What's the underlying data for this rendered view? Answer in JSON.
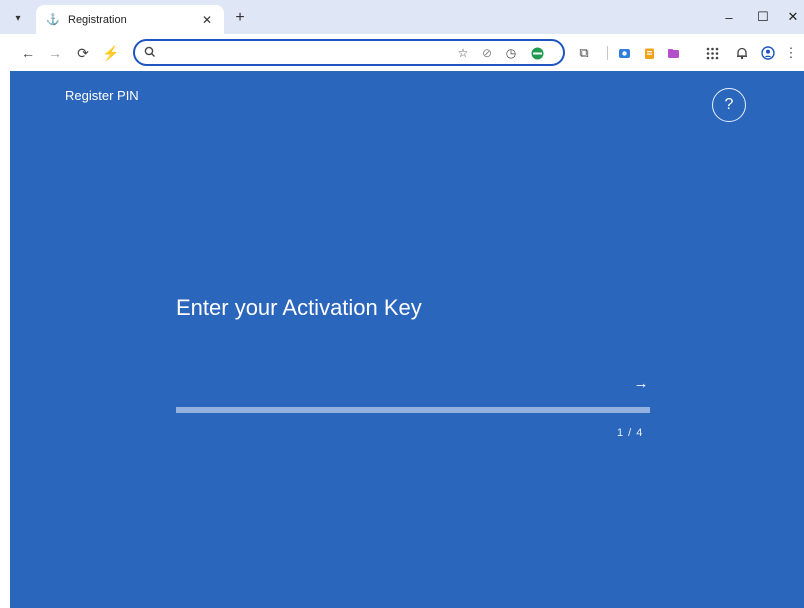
{
  "browser": {
    "tab": {
      "title": "Registration",
      "favicon": "anchor-icon"
    },
    "controls": {
      "minimize": "–",
      "maximize": "☐",
      "close": "✕"
    },
    "nav": {
      "back": "←",
      "forward": "→",
      "reload": "⟳",
      "extension": "⚡"
    },
    "address": {
      "value": "",
      "placeholder": ""
    },
    "toolbar_icons": [
      "star-icon",
      "shield-icon",
      "clock-icon",
      "green-circle-icon",
      "puzzle-icon",
      "camera-icon",
      "clipboard-icon",
      "folder-icon",
      "apps-icon",
      "bell-icon",
      "profile-icon",
      "menu-icon"
    ]
  },
  "page": {
    "brand": "Register PIN",
    "help": "?",
    "heading": "Enter your Activation Key",
    "key_input": {
      "value": "",
      "placeholder": ""
    },
    "next": "→",
    "counter": "1 / 4",
    "colors": {
      "background": "#2b66bd",
      "underline": "#93b0df",
      "text": "#ffffff"
    }
  }
}
